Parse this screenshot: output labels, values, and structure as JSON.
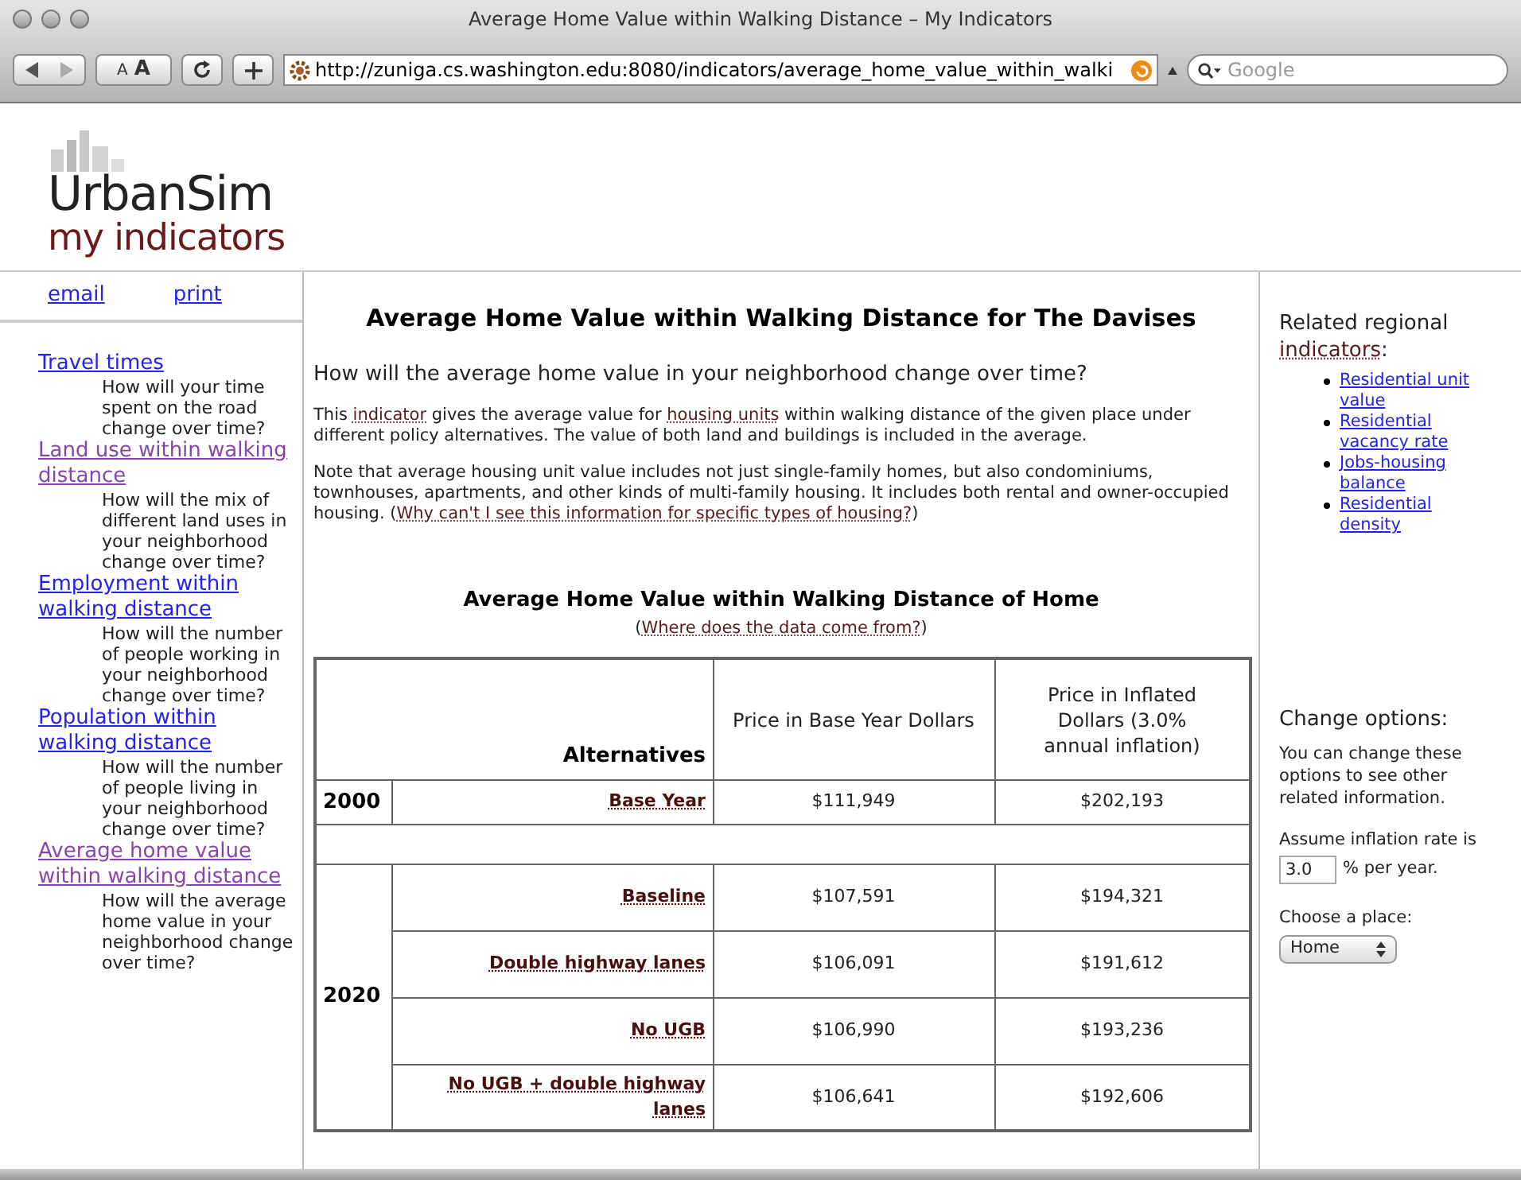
{
  "window": {
    "title": "Average Home Value within Walking Distance – My Indicators"
  },
  "toolbar": {
    "font_small": "A",
    "font_large": "A",
    "url": "http://zuniga.cs.washington.edu:8080/indicators/average_home_value_within_walki",
    "search_placeholder": "Google"
  },
  "logo": {
    "name": "UrbanSim",
    "tagline": "my indicators"
  },
  "page_links": [
    "email",
    "print"
  ],
  "sidebar": {
    "items": [
      {
        "label": "Travel times",
        "visited": false,
        "description": "How will your time spent on the road change over time?"
      },
      {
        "label": "Land use within walking distance",
        "visited": true,
        "description": "How will the mix of different land uses in your neighborhood change over time?"
      },
      {
        "label": "Employment within walking distance",
        "visited": false,
        "description": "How will the number of people working in your neighborhood change over time?"
      },
      {
        "label": "Population within walking distance",
        "visited": false,
        "description": "How will the number of people living in your neighborhood change over time?"
      },
      {
        "label": "Average home value within walking distance",
        "visited": true,
        "description": "How will the average home value in your neighborhood change over time?"
      }
    ]
  },
  "main": {
    "title": "Average Home Value within Walking Distance for The Davises",
    "question": "How will the average home value in your neighborhood change over time?",
    "paragraphs": [
      [
        {
          "text": "This "
        },
        {
          "text": "indicator",
          "link": true
        },
        {
          "text": " gives the average value for "
        },
        {
          "text": "housing units",
          "link": true
        },
        {
          "text": " within walking distance of the given place under different policy alternatives. The value of both land and buildings is included in the average."
        }
      ],
      [
        {
          "text": "Note that average housing unit value includes not just single-family homes, but also condominiums, townhouses, apartments, and other kinds of multi-family housing. It includes both rental and owner-occupied housing. ("
        },
        {
          "text": "Why can't I see this information for specific types of housing?",
          "link": true
        },
        {
          "text": ")"
        }
      ]
    ],
    "table_title": "Average Home Value within Walking Distance of Home",
    "table_note": [
      {
        "text": "("
      },
      {
        "text": "Where does the data come from?",
        "link": true
      },
      {
        "text": ")"
      }
    ],
    "table": {
      "columns": [
        "Alternatives",
        "Price in Base Year Dollars",
        "Price in Inflated Dollars (3.0% annual inflation)"
      ],
      "groups": [
        {
          "year": "2000",
          "rows": [
            {
              "alternative": "Base Year",
              "base": "$111,949",
              "inflated": "$202,193"
            }
          ]
        },
        {
          "year": "2020",
          "rows": [
            {
              "alternative": "Baseline",
              "base": "$107,591",
              "inflated": "$194,321"
            },
            {
              "alternative": "Double highway lanes",
              "base": "$106,091",
              "inflated": "$191,612"
            },
            {
              "alternative": "No UGB",
              "base": "$106,990",
              "inflated": "$193,236"
            },
            {
              "alternative": "No UGB + double highway lanes",
              "base": "$106,641",
              "inflated": "$192,606"
            }
          ]
        }
      ]
    }
  },
  "related": {
    "heading": [
      {
        "text": "Related regional "
      },
      {
        "text": "indicators",
        "link": true
      },
      {
        "text": ":"
      }
    ],
    "links": [
      "Residential unit value",
      "Residential vacancy rate",
      "Jobs-housing balance",
      "Residential density"
    ]
  },
  "options": {
    "heading": "Change options:",
    "description": "You can change these options to see other related information.",
    "inflation_before": "Assume inflation rate is",
    "inflation_value": "3.0",
    "inflation_after": "% per year.",
    "place_label": "Choose a place:",
    "place_value": "Home"
  }
}
